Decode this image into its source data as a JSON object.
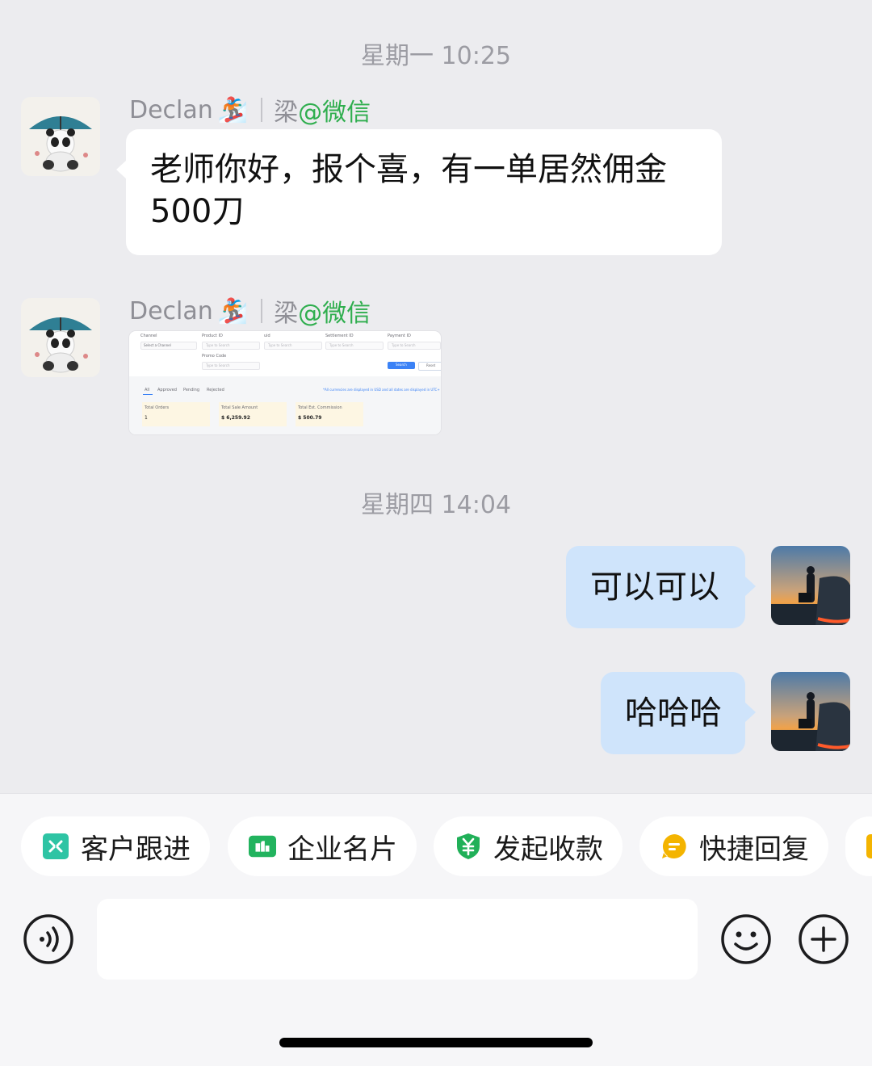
{
  "timestamps": [
    "星期一 10:25",
    "星期四 14:04"
  ],
  "incoming": {
    "sender_name": "Declan",
    "sender_emoji": "🏂",
    "sender_remark": "梁",
    "sender_source": "@微信",
    "message_text": "老师你好，报个喜，有一单居然佣金",
    "message_text_line2": "500刀"
  },
  "screenshot": {
    "filters": [
      "Channel",
      "Product ID",
      "uid",
      "Settlement ID",
      "Payment ID"
    ],
    "select_placeholder": "Select a Channel",
    "input_placeholder": "Type to Search",
    "promo_label": "Promo Code",
    "search_button": "Search",
    "reset_button": "Reset",
    "tabs": [
      "All",
      "Approved",
      "Pending",
      "Rejected"
    ],
    "note": "*All currencies are displayed in USD and all dates are displayed in UTC+",
    "stats": [
      {
        "label": "Total Orders",
        "value": "1"
      },
      {
        "label": "Total Sale Amount",
        "value": "$ 6,259.92"
      },
      {
        "label": "Total Est. Commission",
        "value": "$ 500.79"
      }
    ]
  },
  "outgoing": [
    {
      "text": "可以可以"
    },
    {
      "text": "哈哈哈"
    }
  ],
  "toolbar": {
    "chips": [
      {
        "label": "客户跟进",
        "icon": "customer-followup-icon",
        "color": "#2ec4a4"
      },
      {
        "label": "企业名片",
        "icon": "business-card-icon",
        "color": "#22b35e"
      },
      {
        "label": "发起收款",
        "icon": "payment-shield-icon",
        "color": "#20b058"
      },
      {
        "label": "快捷回复",
        "icon": "quick-reply-icon",
        "color": "#f4b400"
      }
    ],
    "voice_icon": "voice-icon",
    "emoji_icon": "emoji-icon",
    "plus_icon": "plus-icon"
  }
}
